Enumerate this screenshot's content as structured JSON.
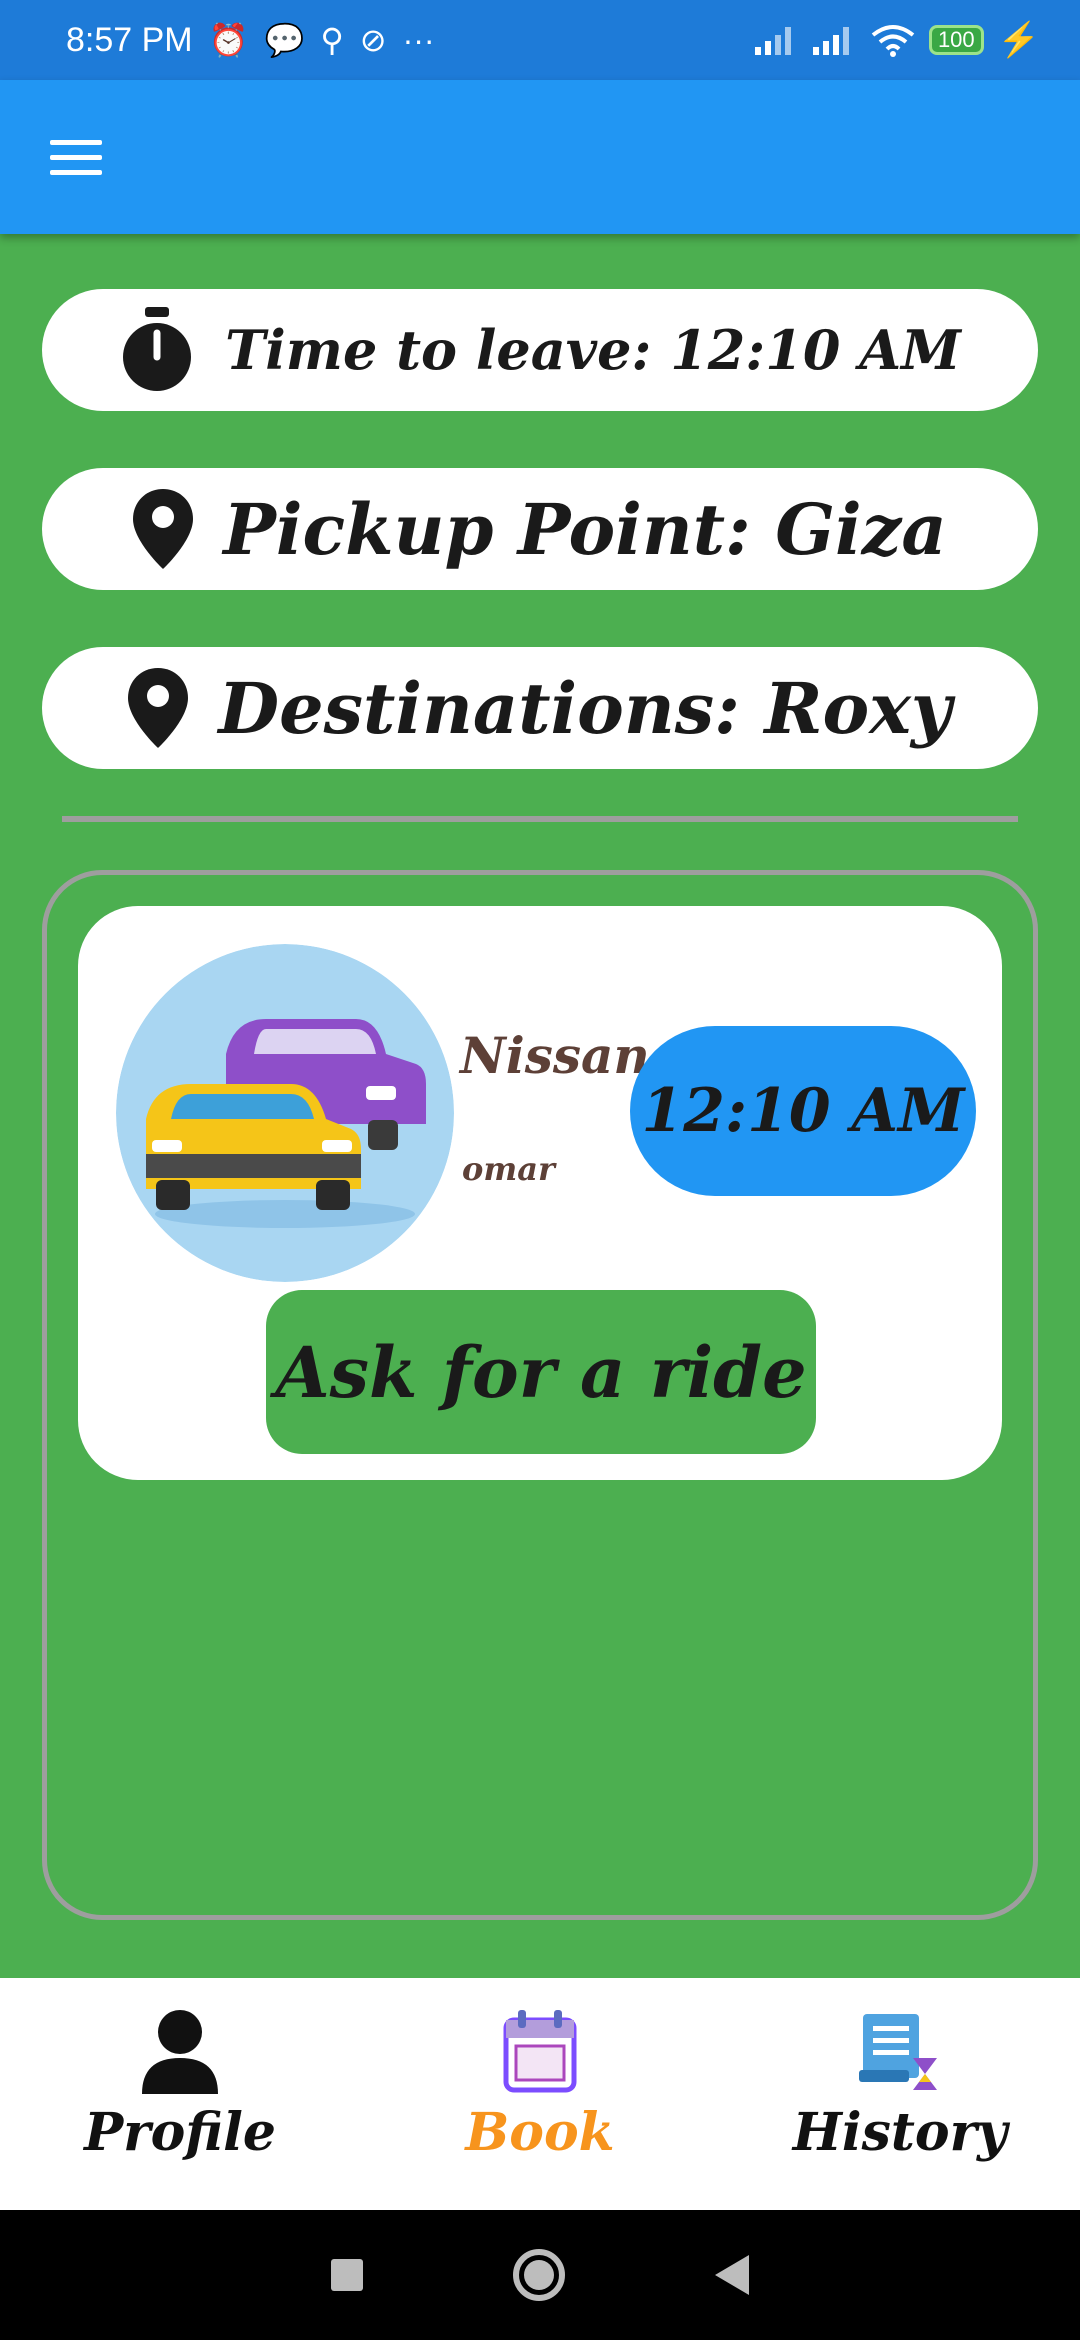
{
  "status_bar": {
    "time": "8:57 PM",
    "icons_left": [
      "alarm-icon",
      "message-icon",
      "app-icon",
      "sync-icon",
      "more-icon"
    ],
    "battery": "100"
  },
  "app_bar": {
    "menu_icon": "hamburger-menu-icon"
  },
  "info": {
    "time_to_leave": "Time to leave:  12:10 AM",
    "pickup": "Pickup Point: Giza",
    "destination": "Destinations: Roxy"
  },
  "rides": [
    {
      "car": "Nissan",
      "driver": "omar",
      "time": "12:10 AM",
      "button": "Ask for a ride"
    }
  ],
  "bottom_nav": {
    "items": [
      {
        "label": "Profile",
        "icon": "person-icon"
      },
      {
        "label": "Book",
        "icon": "calendar-icon",
        "active": true
      },
      {
        "label": "History",
        "icon": "history-icon"
      }
    ]
  },
  "colors": {
    "background": "#4CAF50",
    "app_bar": "#2196F3",
    "active_nav": "#F7941D",
    "text_brown": "#5D4037"
  }
}
